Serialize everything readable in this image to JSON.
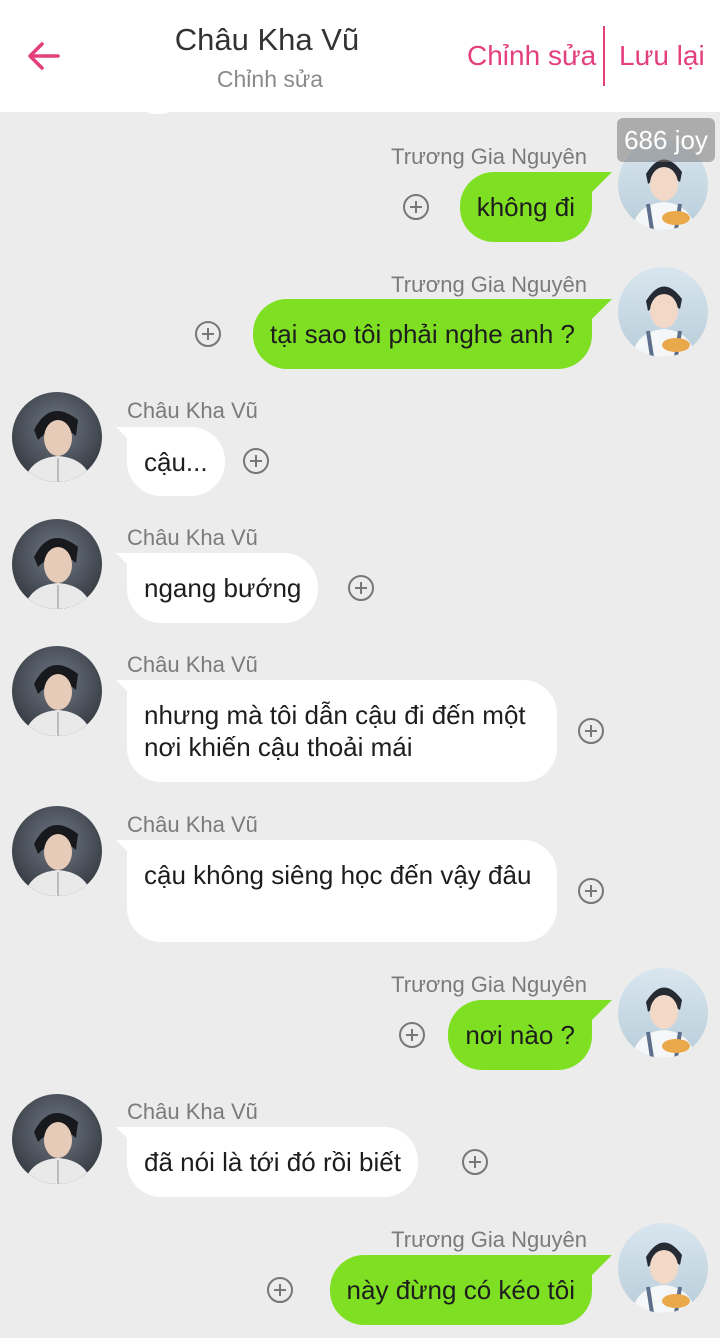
{
  "header": {
    "title": "Châu Kha Vũ",
    "subtitle": "Chỉnh sửa",
    "edit_label": "Chỉnh sửa",
    "save_label": "Lưu lại",
    "accent_color": "#e3407d"
  },
  "watermark": "686 joy",
  "messages": [
    {
      "side": "me",
      "sender": "Trương Gia Nguyên",
      "text": "không đi"
    },
    {
      "side": "me",
      "sender": "Trương Gia Nguyên",
      "text": "tại sao tôi phải nghe anh ?"
    },
    {
      "side": "them",
      "sender": "Châu Kha Vũ",
      "text": "cậu..."
    },
    {
      "side": "them",
      "sender": "Châu Kha Vũ",
      "text": "ngang bướng"
    },
    {
      "side": "them",
      "sender": "Châu Kha Vũ",
      "text": "nhưng mà tôi dẫn cậu đi đến một nơi khiến cậu thoải mái"
    },
    {
      "side": "them",
      "sender": "Châu Kha Vũ",
      "text": "cậu không siêng học đến vậy đâu"
    },
    {
      "side": "me",
      "sender": "Trương Gia Nguyên",
      "text": "nơi nào ?"
    },
    {
      "side": "them",
      "sender": "Châu Kha Vũ",
      "text": "đã nói là tới đó rồi biết"
    },
    {
      "side": "me",
      "sender": "Trương Gia Nguyên",
      "text": "này đừng có kéo tôi"
    }
  ],
  "icons": {
    "back": "arrow-left-icon",
    "add": "plus-circle-icon"
  },
  "colors": {
    "me_bubble": "#7fe023",
    "them_bubble": "#ffffff",
    "background": "#ececec"
  }
}
